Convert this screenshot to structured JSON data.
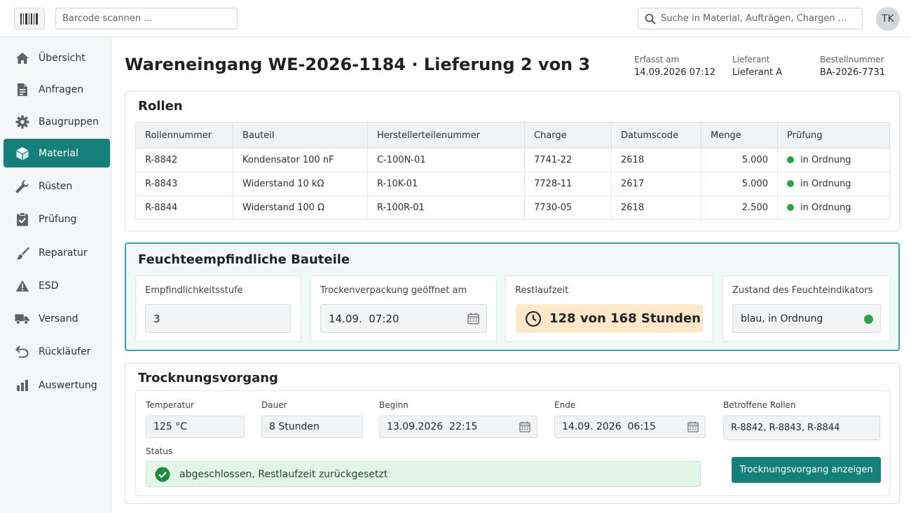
{
  "header": {
    "scan_placeholder": "Barcode scannen ...",
    "search_placeholder": "Suche in Material, Aufträgen, Chargen ...",
    "avatar_initials": "TK"
  },
  "sidebar": {
    "items": [
      {
        "label": "Übersicht",
        "icon": "home-icon"
      },
      {
        "label": "Anfragen",
        "icon": "document-icon"
      },
      {
        "label": "Baugruppen",
        "icon": "gear-icon"
      },
      {
        "label": "Material",
        "icon": "box-icon",
        "active": true
      },
      {
        "label": "Rüsten",
        "icon": "wrench-icon"
      },
      {
        "label": "Prüfung",
        "icon": "checklist-icon"
      },
      {
        "label": "Reparatur",
        "icon": "brush-icon"
      },
      {
        "label": "ESD",
        "icon": "warning-icon"
      },
      {
        "label": "Versand",
        "icon": "truck-icon"
      },
      {
        "label": "Rückläufer",
        "icon": "return-icon"
      },
      {
        "label": "Auswertung",
        "icon": "bar-chart-icon"
      }
    ]
  },
  "page": {
    "title": "Wareneingang WE-2026-1184 · Lieferung 2 von 3",
    "meta": [
      {
        "label": "Erfasst am",
        "value": "14.09.2026 07:12"
      },
      {
        "label": "Lieferant",
        "value": "Lieferant A"
      },
      {
        "label": "Bestellnummer",
        "value": "BA-2026-7731"
      }
    ]
  },
  "rollen": {
    "title": "Rollen",
    "columns": [
      "Rollennummer",
      "Bauteil",
      "Herstellerteilenummer",
      "Charge",
      "Datumscode",
      "Menge",
      "Prüfung"
    ],
    "rows": [
      [
        "R-8842",
        "Kondensator 100 nF",
        "C-100N-01",
        "7741-22",
        "2618",
        "5.000",
        "in Ordnung"
      ],
      [
        "R-8843",
        "Widerstand 10 kΩ",
        "R-10K-01",
        "7728-11",
        "2617",
        "5.000",
        "in Ordnung"
      ],
      [
        "R-8844",
        "Widerstand 100 Ω",
        "R-100R-01",
        "7730-05",
        "2618",
        "2.500",
        "in Ordnung"
      ]
    ]
  },
  "moisture": {
    "title": "Feuchteempfindliche Bauteile",
    "level_label": "Empfindlichkeitsstufe",
    "level_value": "3",
    "opened_label": "Trockenverpackung geöffnet am",
    "opened_value": "14.09.  07:20",
    "rest_label": "Restlaufzeit",
    "rest_value": "128 von 168 Stunden",
    "indicator_label": "Zustand des Feuchteindikators",
    "indicator_value": "blau, in Ordnung",
    "accent_color": "#15807a",
    "warn_color": "#fde8c9"
  },
  "drying": {
    "title": "Trocknungsvorgang",
    "temp_label": "Temperatur",
    "temp_value": "125 °C",
    "duration_label": "Dauer",
    "duration_value": "8 Stunden",
    "start_label": "Beginn",
    "start_value": "13.09.2026  22:15",
    "end_label": "Ende",
    "end_value": "14.09. 2026  06:15",
    "rolls_label": "Betroffene Rollen",
    "rolls_value": "R-8842, R-8843, R-8844",
    "status_label": "Status",
    "status_value": "abgeschlossen, Restlaufzeit zurückgesetzt",
    "button_label": "Trocknungsvorgang anzeigen"
  }
}
